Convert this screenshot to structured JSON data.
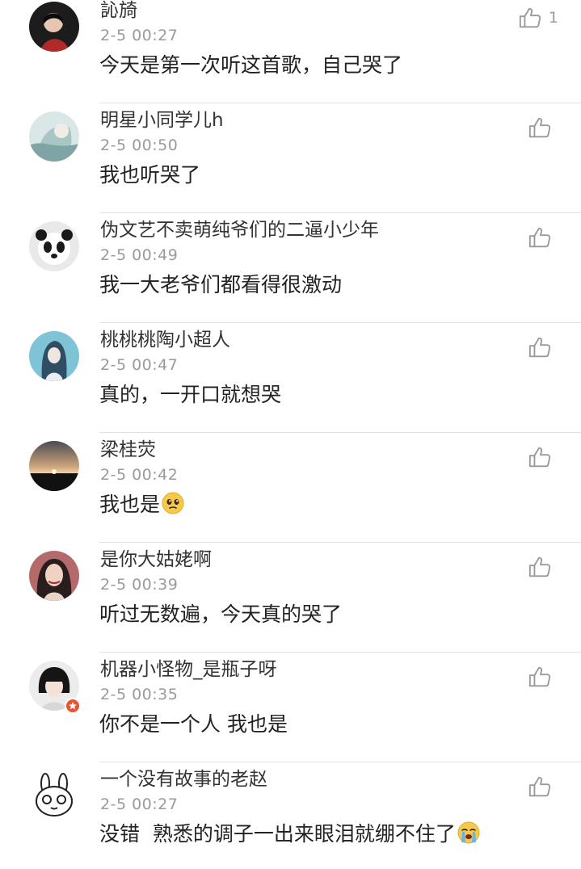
{
  "comments": [
    {
      "name": "訫旑",
      "time": "2-5 00:27",
      "text": "今天是第一次听这首歌，自己哭了",
      "like_count": "1"
    },
    {
      "name": "明星小同学儿h",
      "time": "2-5 00:50",
      "text": "我也听哭了",
      "like_count": ""
    },
    {
      "name": "伪文艺不卖萌纯爷们的二逼小少年",
      "time": "2-5 00:49",
      "text": "我一大老爷们都看得很激动",
      "like_count": ""
    },
    {
      "name": "桃桃桃陶小超人",
      "time": "2-5 00:47",
      "text": "真的，一开口就想哭",
      "like_count": ""
    },
    {
      "name": "梁桂荧",
      "time": "2-5 00:42",
      "text": "我也是",
      "emoji": "pleading-face-emoji",
      "like_count": ""
    },
    {
      "name": "是你大姑姥啊",
      "time": "2-5 00:39",
      "text": "听过无数遍，今天真的哭了",
      "like_count": ""
    },
    {
      "name": "机器小怪物_是瓶子呀",
      "time": "2-5 00:35",
      "text": "你不是一个人 我也是",
      "like_count": ""
    },
    {
      "name": "一个没有故事的老赵",
      "time": "2-5 00:27",
      "text": "没错  熟悉的调子一出来眼泪就绷不住了",
      "emoji": "loudly-crying-emoji",
      "like_count": ""
    }
  ],
  "icons": {
    "like": "thumbs-up-icon"
  },
  "colors": {
    "background": "#ffffff",
    "name_text": "#333333",
    "time_text": "#9a9a9a",
    "body_text": "#222222",
    "divider": "#e2e2e2",
    "icon": "#9a9a9a"
  }
}
